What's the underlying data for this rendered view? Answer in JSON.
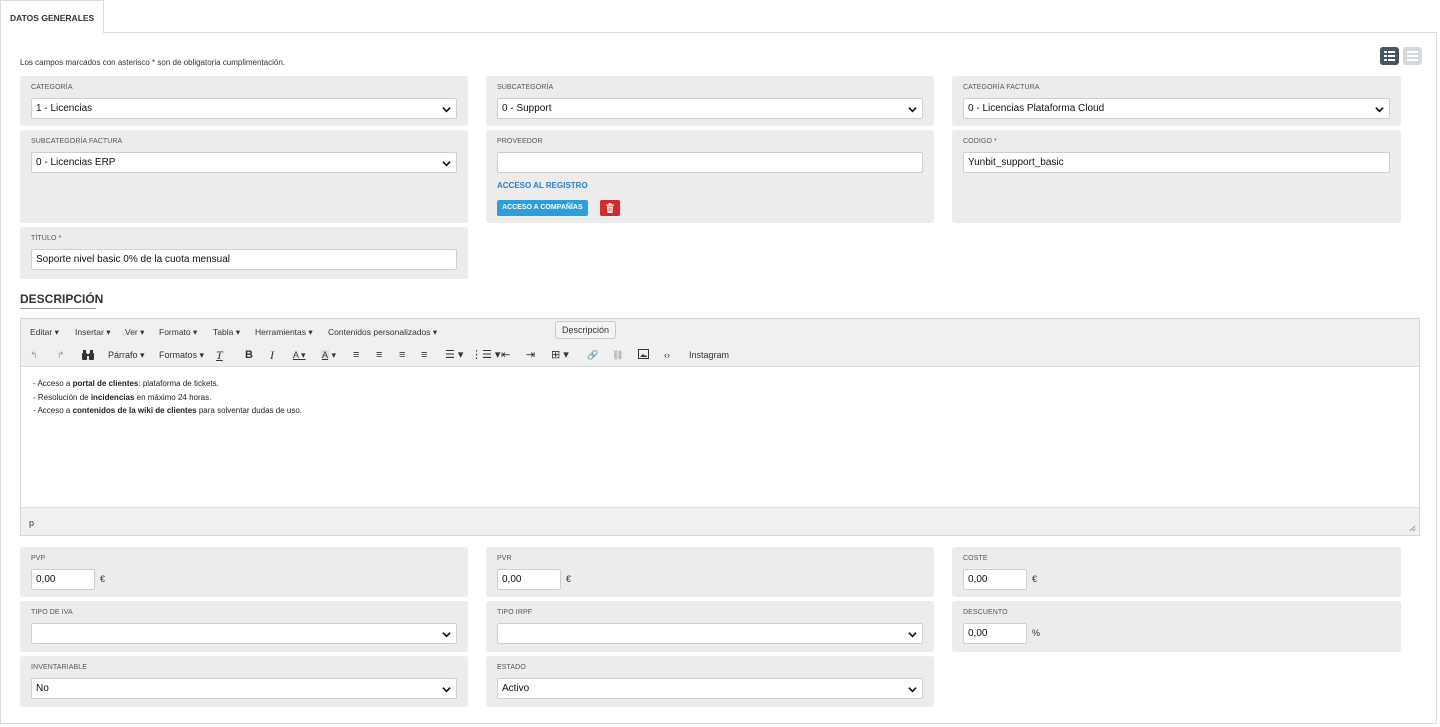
{
  "tab": {
    "label": "DATOS GENERALES"
  },
  "note": "Los campos marcados con asterisco * son de obligatoria cumplimentación.",
  "view_toggle": {
    "grid_icon": "grid-view-icon",
    "list_icon": "list-view-icon"
  },
  "fields": {
    "categoria": {
      "label": "CATEGORÍA",
      "value": "1 - Licencias"
    },
    "subcategoria": {
      "label": "SUBCATEGORÍA",
      "value": "0 - Support"
    },
    "categoria_factura": {
      "label": "CATEGORÍA FACTURA",
      "value": "0 - Licencias Plataforma Cloud"
    },
    "subcategoria_factura": {
      "label": "SUBCATEGORÍA FACTURA",
      "value": "0 - Licencias ERP"
    },
    "proveedor": {
      "label": "PROVEEDOR",
      "value": "",
      "link": "ACCESO AL REGISTRO",
      "button": "ACCESO A COMPAÑÍAS"
    },
    "codigo": {
      "label": "CODIGO *",
      "value": "Yunbit_support_basic"
    },
    "titulo": {
      "label": "TÍTULO *",
      "value": "Soporte nivel basic 0% de la cuota mensual"
    },
    "pvp": {
      "label": "PVP",
      "value": "0,00",
      "unit": "€"
    },
    "pvr": {
      "label": "PVR",
      "value": "0,00",
      "unit": "€"
    },
    "coste": {
      "label": "COSTE",
      "value": "0,00",
      "unit": "€"
    },
    "tipo_iva": {
      "label": "TIPO DE IVA",
      "value": ""
    },
    "tipo_irpf": {
      "label": "TIPO IRPF",
      "value": ""
    },
    "descuento": {
      "label": "DESCUENTO",
      "value": "0,00",
      "unit": "%"
    },
    "inventariable": {
      "label": "INVENTARIABLE",
      "value": "No"
    },
    "estado": {
      "label": "ESTADO",
      "value": "Activo"
    }
  },
  "description": {
    "title": "DESCRIPCIÓN",
    "tooltip": "Descripción",
    "menu": [
      "Editar",
      "Insertar",
      "Ver",
      "Formato",
      "Tabla",
      "Herramientas",
      "Contenidos personalizados"
    ],
    "toolbar": {
      "paragraph": "Párrafo",
      "formats": "Formatos",
      "instagram": "Instagram"
    },
    "lines": [
      {
        "pre": "- Acceso a ",
        "bold": "portal de clientes",
        "post": ": plataforma de tickets."
      },
      {
        "pre": "- Resolución de ",
        "bold": "incidencias",
        "post": " en máximo 24 horas."
      },
      {
        "pre": "- Acceso a ",
        "bold": "contenidos de la wiki de clientes",
        "post": " para solventar dudas de uso."
      }
    ],
    "status_path": "p"
  }
}
